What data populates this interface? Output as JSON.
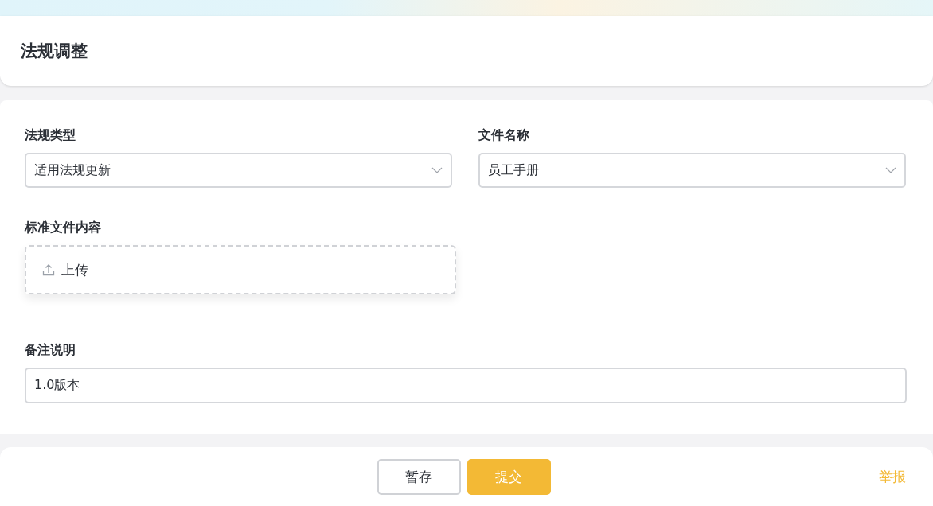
{
  "header": {
    "title": "法规调整"
  },
  "fields": [
    {
      "kind": "select",
      "label": "法规类型",
      "value": "适用法规更新"
    },
    {
      "kind": "select",
      "label": "文件名称",
      "value": "员工手册"
    },
    {
      "kind": "upload",
      "label": "标准文件内容",
      "button": "上传"
    },
    {
      "kind": "text",
      "label": "备注说明",
      "value": "1.0版本"
    }
  ],
  "footer": {
    "buttons": [
      {
        "label": "暂存",
        "kind": "default"
      },
      {
        "label": "提交",
        "kind": "primary"
      }
    ],
    "report_link": "举报"
  }
}
